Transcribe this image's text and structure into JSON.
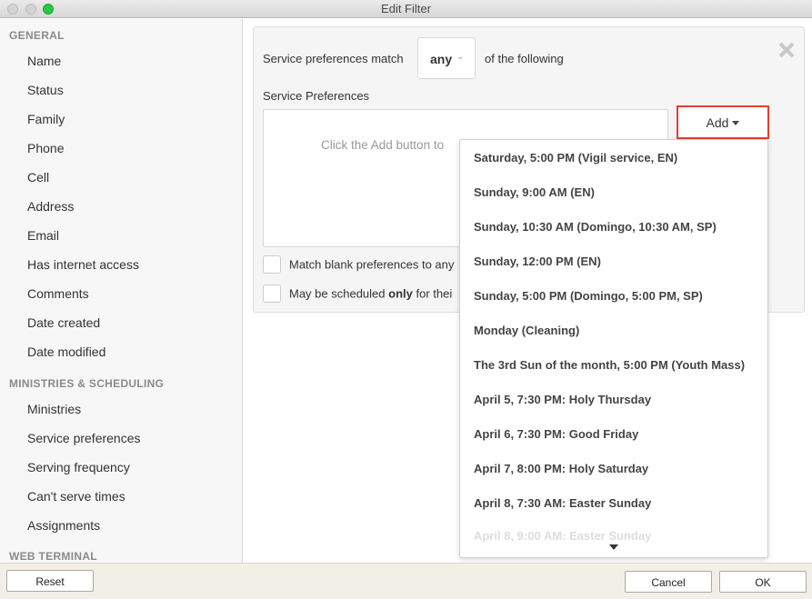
{
  "window": {
    "title": "Edit Filter"
  },
  "sidebar": {
    "sections": [
      {
        "heading": "GENERAL",
        "items": [
          "Name",
          "Status",
          "Family",
          "Phone",
          "Cell",
          "Address",
          "Email",
          "Has internet access",
          "Comments",
          "Date created",
          "Date modified"
        ]
      },
      {
        "heading": "MINISTRIES & SCHEDULING",
        "items": [
          "Ministries",
          "Service preferences",
          "Serving frequency",
          "Can't serve times",
          "Assignments"
        ]
      },
      {
        "heading": "WEB TERMINAL",
        "items": []
      }
    ]
  },
  "filter": {
    "match_prefix": "Service preferences match",
    "match_value": "any",
    "match_suffix": "of the following",
    "preferences_label": "Service Preferences",
    "preferences_hint": "Click the Add button to",
    "add_label": "Add",
    "checkbox_match_blank": "Match blank preferences to any",
    "checkbox_scheduled_prefix": "May be scheduled ",
    "checkbox_scheduled_bold": "only",
    "checkbox_scheduled_suffix": " for thei"
  },
  "dropdown": {
    "items": [
      "Saturday, 5:00 PM (Vigil service, EN)",
      "Sunday, 9:00 AM (EN)",
      "Sunday, 10:30 AM (Domingo, 10:30 AM, SP)",
      "Sunday, 12:00 PM (EN)",
      "Sunday, 5:00 PM (Domingo, 5:00 PM, SP)",
      "Monday (Cleaning)",
      "The 3rd Sun of the month, 5:00 PM (Youth Mass)",
      "April 5, 7:30 PM: Holy Thursday",
      "April 6, 7:30 PM: Good Friday",
      "April 7, 8:00 PM: Holy Saturday",
      "April 8, 7:30 AM: Easter Sunday",
      "April 8, 9:00 AM: Easter Sunday"
    ]
  },
  "footer": {
    "reset": "Reset",
    "cancel": "Cancel",
    "ok": "OK"
  },
  "colors": {
    "highlight": "#e2402d",
    "zoom": "#28c940"
  }
}
